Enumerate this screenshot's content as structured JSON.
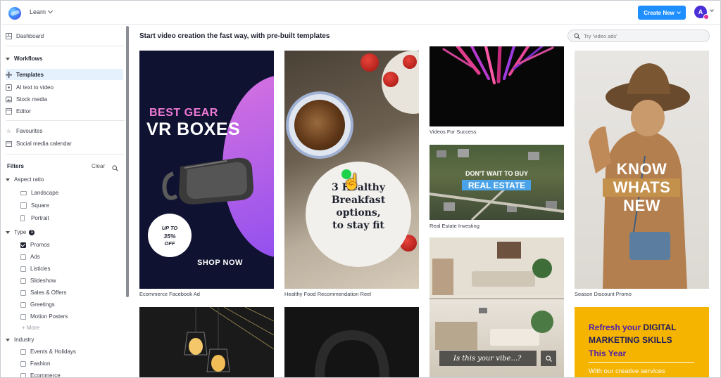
{
  "topbar": {
    "learn_label": "Learn",
    "create_label": "Create New",
    "avatar_initial": "A",
    "brand_color": "#1f8fff"
  },
  "sidebar": {
    "dashboard": "Dashboard",
    "workflows": "Workflows",
    "items": [
      {
        "label": "Templates",
        "icon": "plus-icon",
        "active": true
      },
      {
        "label": "AI text to video",
        "icon": "ai-icon"
      },
      {
        "label": "Stock media",
        "icon": "stock-media-icon"
      },
      {
        "label": "Editor",
        "icon": "editor-icon"
      }
    ],
    "favourites": "Favourites",
    "calendar": "Social media calendar"
  },
  "filters": {
    "title": "Filters",
    "clear": "Clear",
    "aspect_ratio": {
      "label": "Aspect ratio",
      "options": [
        "Landscape",
        "Square",
        "Portrait"
      ]
    },
    "type": {
      "label": "Type",
      "count": "1",
      "options": [
        {
          "label": "Promos",
          "checked": true
        },
        {
          "label": "Ads",
          "checked": false
        },
        {
          "label": "Listicles",
          "checked": false
        },
        {
          "label": "Slideshow",
          "checked": false
        },
        {
          "label": "Sales & Offers",
          "checked": false
        },
        {
          "label": "Greetings",
          "checked": false
        },
        {
          "label": "Motion Posters",
          "checked": false
        }
      ],
      "more": "+ More"
    },
    "industry": {
      "label": "Industry",
      "options": [
        "Events & Holidays",
        "Fashion",
        "Ecommerce"
      ]
    }
  },
  "main": {
    "title": "Start video creation the fast way, with pre-built templates",
    "search_placeholder": "Try 'video ads'"
  },
  "templates": {
    "vr": {
      "caption": "Ecommerce Facebook Ad",
      "line1": "BEST GEAR",
      "line2": "VR BOXES",
      "up_to": "UP TO",
      "pct": "35%",
      "off": "OFF",
      "cta": "SHOP NOW"
    },
    "food": {
      "caption": "Healthy Food Recommendation Reel",
      "l1": "3 Healthy",
      "l2": "Breakfast",
      "l3": "options,",
      "l4": "to stay fit"
    },
    "success": {
      "caption": "Videos For Success"
    },
    "realestate": {
      "caption": "Real Estate Investing",
      "l1": "DON'T WAIT TO BUY",
      "l2": "REAL ESTATE"
    },
    "vibe": {
      "text": "Is this your vibe...?"
    },
    "season": {
      "caption": "Season Discount Promo",
      "l1": "KNOW",
      "l2": "WHATS",
      "l3": "NEW"
    },
    "digital": {
      "r1a": "Refresh your ",
      "r1b": "DIGITAL",
      "r2": "MARKETING SKILLS",
      "r3": "This Year",
      "r4": "With our creative services"
    }
  }
}
